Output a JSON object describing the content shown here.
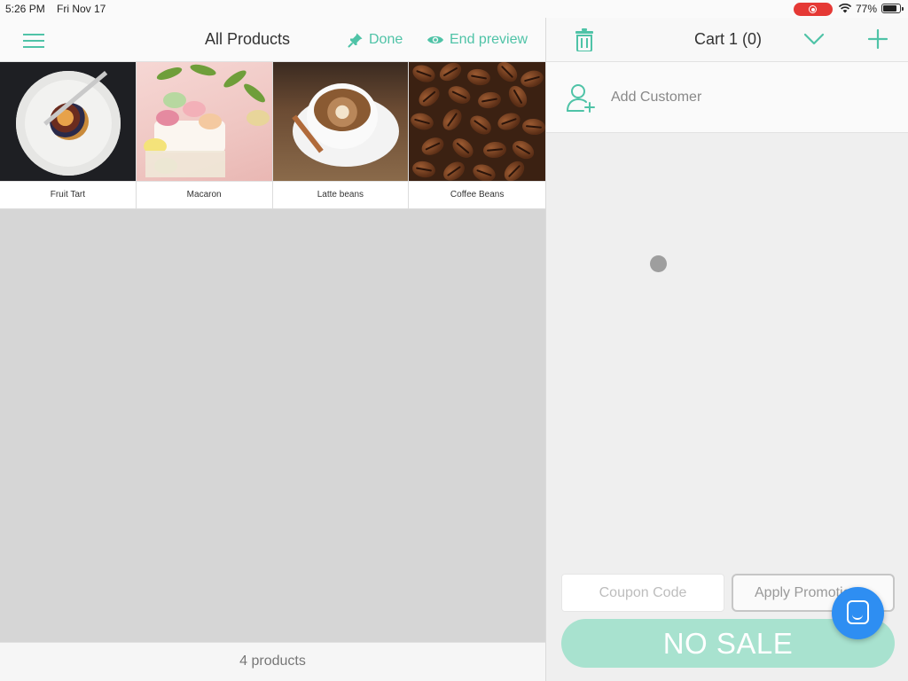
{
  "status_bar": {
    "time": "5:26 PM",
    "date": "Fri Nov 17",
    "battery": "77%"
  },
  "header": {
    "title": "All Products",
    "done_label": "Done",
    "end_preview_label": "End preview"
  },
  "products": [
    {
      "name": "Fruit Tart"
    },
    {
      "name": "Macaron"
    },
    {
      "name": "Latte beans"
    },
    {
      "name": "Coffee Beans"
    }
  ],
  "footer": {
    "count_text": "4 products"
  },
  "cart": {
    "title": "Cart 1 (0)",
    "add_customer_label": "Add Customer",
    "coupon_placeholder": "Coupon Code",
    "apply_promo_label": "Apply Promotion",
    "no_sale_label": "NO SALE"
  },
  "colors": {
    "accent": "#4fc3a7",
    "no_sale_bg": "#a8e2cf",
    "chat_fab": "#2e8ef2",
    "record_indicator": "#e53935"
  },
  "icons": {
    "menu": "hamburger-icon",
    "done": "pin-icon",
    "end_preview": "eye-icon",
    "trash": "trash-icon",
    "chevron": "chevron-down-icon",
    "plus": "plus-icon",
    "add_customer": "add-person-icon",
    "chat": "chat-bubble-icon"
  }
}
